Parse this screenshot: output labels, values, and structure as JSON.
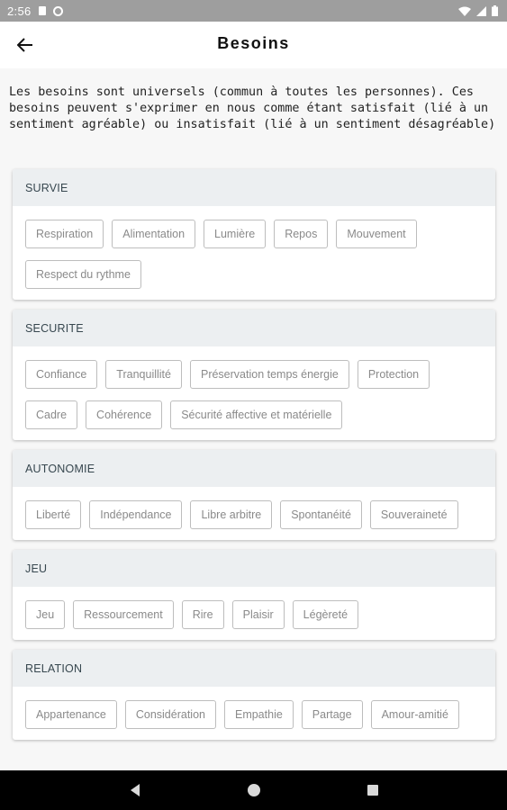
{
  "status_bar": {
    "time": "2:56",
    "icons": [
      "sd-card-icon",
      "no-sim-icon",
      "wifi-icon",
      "signal-icon",
      "battery-icon"
    ]
  },
  "app_bar": {
    "title": "Besoins",
    "back_icon": "arrow-back-icon"
  },
  "intro": "Les besoins sont universels (commun à toutes les personnes). Ces besoins peuvent s'exprimer en nous comme étant satisfait (lié à un sentiment agréable) ou insatisfait (lié à un sentiment désagréable)",
  "categories": [
    {
      "title": "SURVIE",
      "needs": [
        "Respiration",
        "Alimentation",
        "Lumière",
        "Repos",
        "Mouvement",
        "Respect du rythme"
      ]
    },
    {
      "title": "SECURITE",
      "needs": [
        "Confiance",
        "Tranquillité",
        "Préservation temps énergie",
        "Protection",
        "Cadre",
        "Cohérence",
        "Sécurité affective et matérielle"
      ]
    },
    {
      "title": "AUTONOMIE",
      "needs": [
        "Liberté",
        "Indépendance",
        "Libre arbitre",
        "Spontanéité",
        "Souveraineté"
      ]
    },
    {
      "title": "JEU",
      "needs": [
        "Jeu",
        "Ressourcement",
        "Rire",
        "Plaisir",
        "Légèreté"
      ]
    },
    {
      "title": "RELATION",
      "needs": [
        "Appartenance",
        "Considération",
        "Empathie",
        "Partage",
        "Amour-amitié"
      ]
    }
  ],
  "nav_bar": {
    "icons": [
      "back-triangle-icon",
      "home-circle-icon",
      "recents-square-icon"
    ]
  },
  "colors": {
    "status_bar": "#9e9e9e",
    "card_header": "#eceff1",
    "chip_border": "#bdbdbd",
    "chip_text": "#8a8a8a",
    "nav_bar": "#000000"
  }
}
